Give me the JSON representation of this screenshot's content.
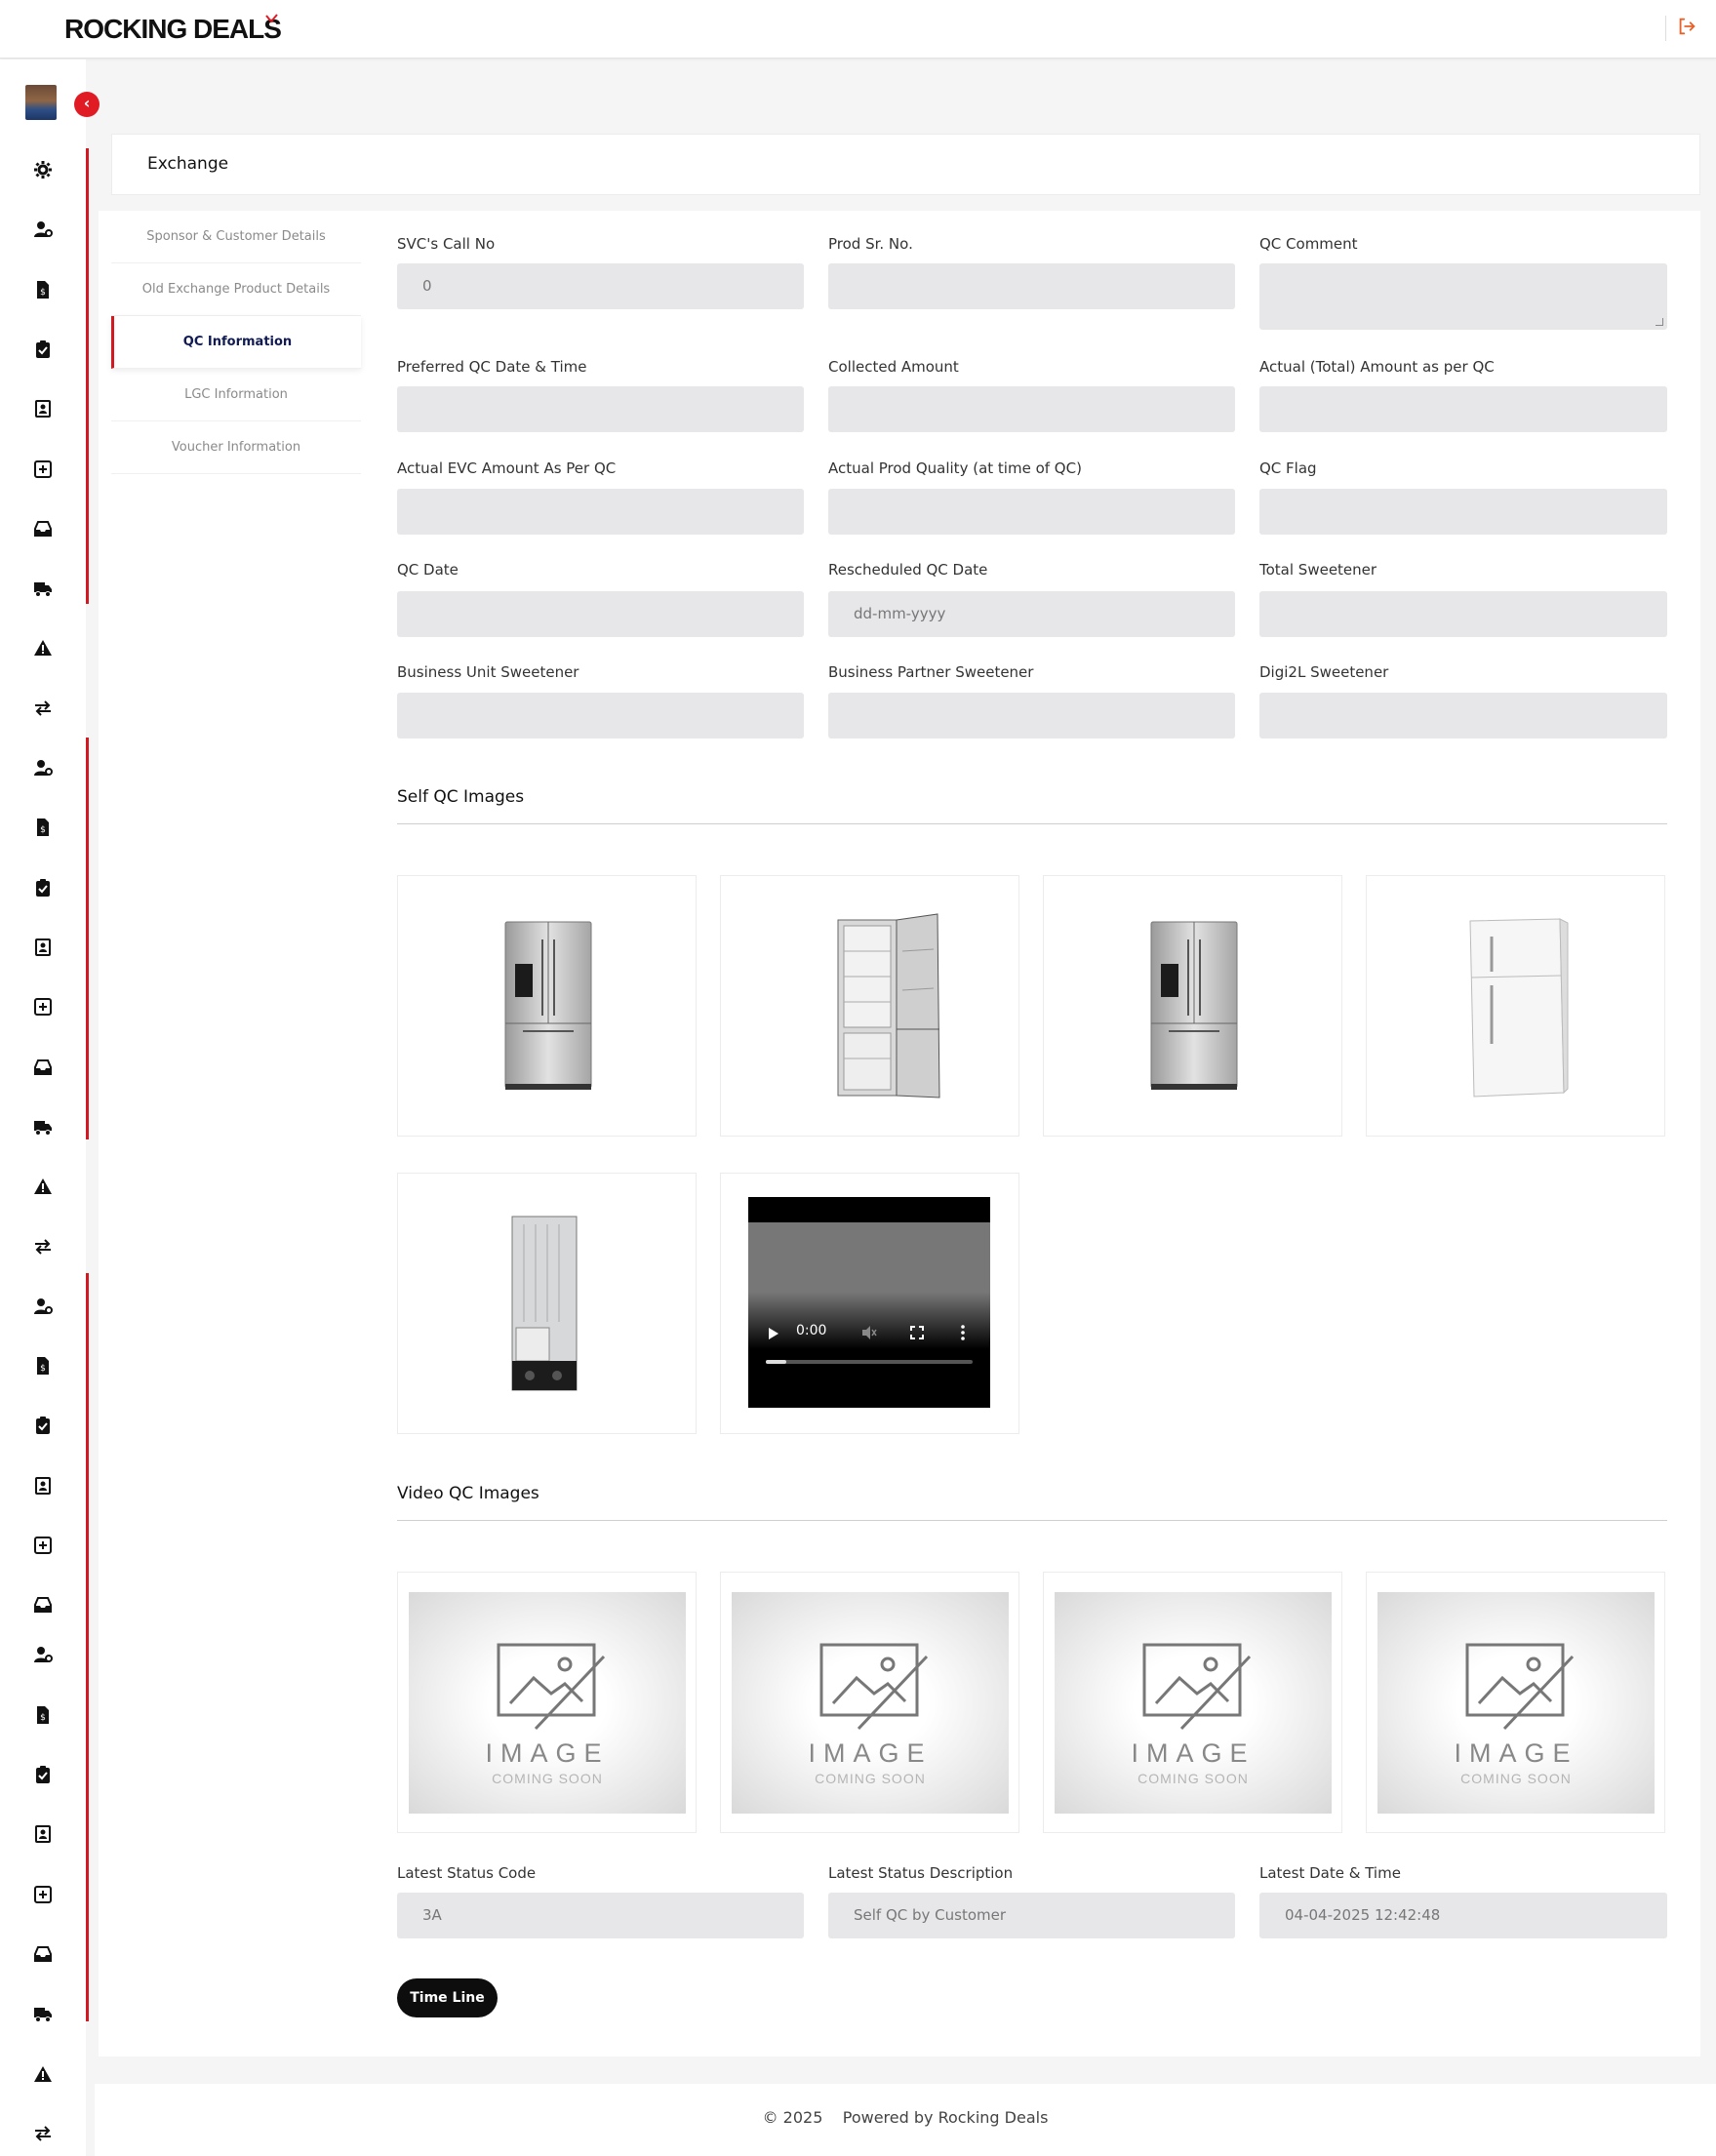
{
  "header": {
    "logo": "ROCKING DEALS",
    "logo_mark": "RD"
  },
  "sidebar": {
    "icons": [
      "gear-icon",
      "user-cog-icon",
      "file-invoice-icon",
      "clipboard-check-icon",
      "contact-card-icon",
      "plus-square-icon",
      "inbox-icon",
      "truck-icon",
      "warning-icon",
      "exchange-icon",
      "user-cog-icon",
      "file-invoice-icon",
      "clipboard-check-icon",
      "contact-card-icon",
      "plus-square-icon",
      "inbox-icon",
      "truck-icon",
      "warning-icon",
      "exchange-icon",
      "user-cog-icon",
      "file-invoice-icon",
      "clipboard-check-icon",
      "contact-card-icon",
      "plus-square-icon",
      "inbox-icon",
      "user-cog-icon",
      "file-invoice-icon",
      "clipboard-check-icon",
      "contact-card-icon",
      "plus-square-icon",
      "inbox-icon",
      "truck-icon",
      "warning-icon",
      "exchange-icon"
    ]
  },
  "page": {
    "title": "Exchange"
  },
  "subnav": [
    {
      "label": "Sponsor & Customer Details",
      "active": false
    },
    {
      "label": "Old Exchange Product Details",
      "active": false
    },
    {
      "label": "QC Information",
      "active": true
    },
    {
      "label": "LGC Information",
      "active": false
    },
    {
      "label": "Voucher Information",
      "active": false
    }
  ],
  "fields": {
    "svc_call_no": {
      "label": "SVC's Call No",
      "value": "0"
    },
    "prod_sr_no": {
      "label": "Prod Sr. No.",
      "value": ""
    },
    "qc_comment": {
      "label": "QC Comment",
      "value": ""
    },
    "preferred_qc_datetime": {
      "label": "Preferred QC Date & Time",
      "value": ""
    },
    "collected_amount": {
      "label": "Collected Amount",
      "value": ""
    },
    "actual_total_amount": {
      "label": "Actual (Total) Amount as per QC",
      "value": ""
    },
    "actual_evc_amount": {
      "label": "Actual EVC Amount As Per QC",
      "value": ""
    },
    "actual_prod_quality": {
      "label": "Actual Prod Quality (at time of QC)",
      "value": ""
    },
    "qc_flag": {
      "label": "QC Flag",
      "value": ""
    },
    "qc_date": {
      "label": "QC Date",
      "value": ""
    },
    "rescheduled_qc_date": {
      "label": "Rescheduled QC Date",
      "value": "",
      "placeholder": "dd-mm-yyyy"
    },
    "total_sweetener": {
      "label": "Total Sweetener",
      "value": ""
    },
    "bu_sweetener": {
      "label": "Business Unit Sweetener",
      "value": ""
    },
    "bp_sweetener": {
      "label": "Business Partner Sweetener",
      "value": ""
    },
    "digi2l_sweetener": {
      "label": "Digi2L Sweetener",
      "value": ""
    },
    "latest_status_code": {
      "label": "Latest Status Code",
      "value": "3A"
    },
    "latest_status_desc": {
      "label": "Latest Status Description",
      "value": "Self QC by Customer"
    },
    "latest_datetime": {
      "label": "Latest Date & Time",
      "value": "04-04-2025 12:42:48"
    }
  },
  "self_qc": {
    "title": "Self QC Images",
    "video": {
      "time": "0:00",
      "progress": 0.1
    }
  },
  "video_qc": {
    "title": "Video QC Images",
    "placeholder_big": "IMAGE",
    "placeholder_small": "COMING SOON"
  },
  "timeline_button": "Time Line",
  "footer": {
    "copyright": "© 2025",
    "powered": "Powered by Rocking Deals"
  },
  "colors": {
    "brand_red": "#d21820",
    "field_bg": "#e7e7e9",
    "button_dark": "#0d0d0d"
  }
}
